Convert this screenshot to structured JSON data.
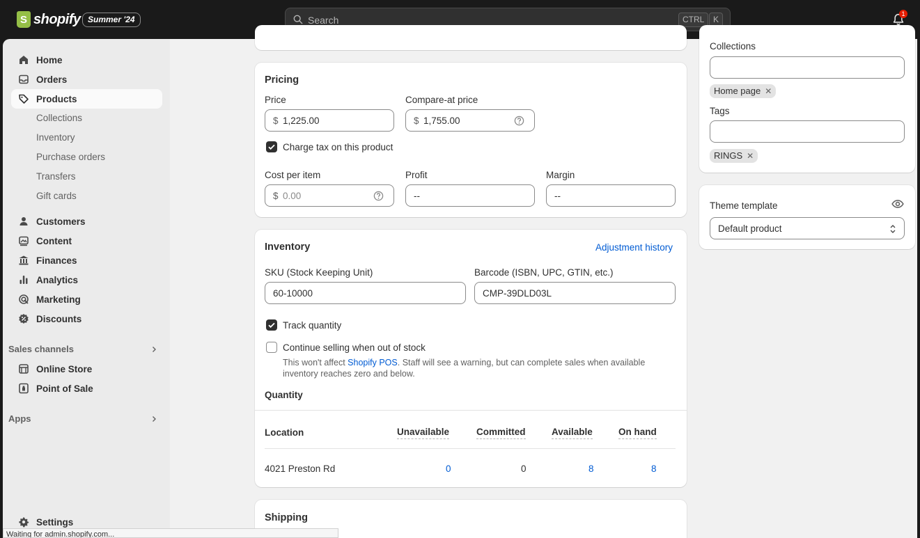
{
  "topbar": {
    "brand": "shopify",
    "edition_badge": "Summer '24",
    "search_placeholder": "Search",
    "shortcut_keys": [
      "CTRL",
      "K"
    ],
    "notification_count": "1"
  },
  "sidebar": {
    "items": [
      {
        "label": "Home",
        "icon": "home-icon"
      },
      {
        "label": "Orders",
        "icon": "inbox-icon"
      },
      {
        "label": "Products",
        "icon": "tag-icon",
        "active": true
      }
    ],
    "product_subitems": [
      "Collections",
      "Inventory",
      "Purchase orders",
      "Transfers",
      "Gift cards"
    ],
    "items2": [
      {
        "label": "Customers",
        "icon": "person-icon"
      },
      {
        "label": "Content",
        "icon": "image-icon"
      },
      {
        "label": "Finances",
        "icon": "bank-icon"
      },
      {
        "label": "Analytics",
        "icon": "bar-chart-icon"
      },
      {
        "label": "Marketing",
        "icon": "target-icon"
      },
      {
        "label": "Discounts",
        "icon": "discount-icon"
      }
    ],
    "sales_channels_title": "Sales channels",
    "channels": [
      {
        "label": "Online Store",
        "icon": "store-icon"
      },
      {
        "label": "Point of Sale",
        "icon": "pos-icon"
      }
    ],
    "apps_title": "Apps",
    "settings_label": "Settings"
  },
  "pricing": {
    "title": "Pricing",
    "price_label": "Price",
    "currency": "$",
    "price_value": "1,225.00",
    "compare_label": "Compare-at price",
    "compare_value": "1,755.00",
    "charge_tax_label": "Charge tax on this product",
    "cost_label": "Cost per item",
    "cost_placeholder": "0.00",
    "profit_label": "Profit",
    "profit_value": "--",
    "margin_label": "Margin",
    "margin_value": "--"
  },
  "inventory": {
    "title": "Inventory",
    "adjustment_link": "Adjustment history",
    "sku_label": "SKU (Stock Keeping Unit)",
    "sku_value": "60-10000",
    "barcode_label": "Barcode (ISBN, UPC, GTIN, etc.)",
    "barcode_value": "CMP-39DLD03L",
    "track_label": "Track quantity",
    "continue_label": "Continue selling when out of stock",
    "help_prefix": "This won't affect ",
    "help_link": "Shopify POS",
    "help_line1_rest": ". Staff will see a warning, but can complete sales when available",
    "help_line2": "inventory reaches zero and below.",
    "quantity_title": "Quantity",
    "columns": [
      "Location",
      "Unavailable",
      "Committed",
      "Available",
      "On hand"
    ],
    "row": {
      "location": "4021 Preston Rd",
      "unavailable": "0",
      "committed": "0",
      "available": "8",
      "on_hand": "8"
    }
  },
  "shipping": {
    "title": "Shipping"
  },
  "organization": {
    "collections_label": "Collections",
    "collection_chip": "Home page",
    "tags_label": "Tags",
    "tag_chip": "RINGS"
  },
  "theme": {
    "label": "Theme template",
    "selected": "Default product"
  },
  "status_bar": "Waiting for admin.shopify.com..."
}
